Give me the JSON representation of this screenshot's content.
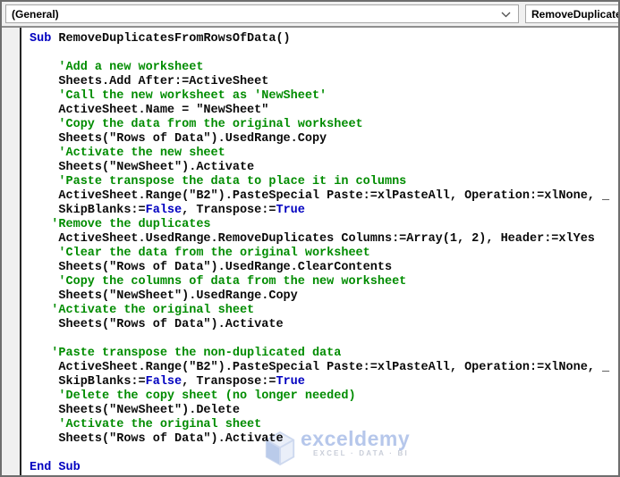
{
  "toolbar": {
    "object_dropdown": {
      "value": "(General)"
    },
    "procedure_dropdown": {
      "value": "RemoveDuplicatesF"
    }
  },
  "watermark": {
    "brand": "exceldemy",
    "tagline": "EXCEL · DATA · BI"
  },
  "colors": {
    "keyword": "#0000c0",
    "comment": "#008c00",
    "code_text": "#0a0a0a",
    "watermark_brand": "#b3c5ea",
    "margin_bar_bg": "#f0f0f0"
  },
  "code": {
    "lines": [
      [
        {
          "c": "k",
          "t": "Sub"
        },
        {
          "c": "d",
          "t": " RemoveDuplicatesFromRowsOfData()"
        }
      ],
      [],
      [
        {
          "c": "c",
          "t": "    'Add a new worksheet"
        }
      ],
      [
        {
          "c": "d",
          "t": "    Sheets.Add After:=ActiveSheet"
        }
      ],
      [
        {
          "c": "c",
          "t": "    'Call the new worksheet as 'NewSheet'"
        }
      ],
      [
        {
          "c": "d",
          "t": "    ActiveSheet.Name = \"NewSheet\""
        }
      ],
      [
        {
          "c": "c",
          "t": "    'Copy the data from the original worksheet"
        }
      ],
      [
        {
          "c": "d",
          "t": "    Sheets(\"Rows of Data\").UsedRange.Copy"
        }
      ],
      [
        {
          "c": "c",
          "t": "    'Activate the new sheet"
        }
      ],
      [
        {
          "c": "d",
          "t": "    Sheets(\"NewSheet\").Activate"
        }
      ],
      [
        {
          "c": "c",
          "t": "    'Paste transpose the data to place it in columns"
        }
      ],
      [
        {
          "c": "d",
          "t": "    ActiveSheet.Range(\"B2\").PasteSpecial Paste:=xlPasteAll, Operation:=xlNone, _"
        }
      ],
      [
        {
          "c": "d",
          "t": "    SkipBlanks:="
        },
        {
          "c": "k",
          "t": "False"
        },
        {
          "c": "d",
          "t": ", Transpose:="
        },
        {
          "c": "k",
          "t": "True"
        }
      ],
      [
        {
          "c": "c",
          "t": "   'Remove the duplicates"
        }
      ],
      [
        {
          "c": "d",
          "t": "    ActiveSheet.UsedRange.RemoveDuplicates Columns:=Array(1, 2), Header:=xlYes"
        }
      ],
      [
        {
          "c": "c",
          "t": "    'Clear the data from the original worksheet"
        }
      ],
      [
        {
          "c": "d",
          "t": "    Sheets(\"Rows of Data\").UsedRange.ClearContents"
        }
      ],
      [
        {
          "c": "c",
          "t": "    'Copy the columns of data from the new worksheet"
        }
      ],
      [
        {
          "c": "d",
          "t": "    Sheets(\"NewSheet\").UsedRange.Copy"
        }
      ],
      [
        {
          "c": "c",
          "t": "   'Activate the original sheet"
        }
      ],
      [
        {
          "c": "d",
          "t": "    Sheets(\"Rows of Data\").Activate"
        }
      ],
      [],
      [
        {
          "c": "c",
          "t": "   'Paste transpose the non-duplicated data"
        }
      ],
      [
        {
          "c": "d",
          "t": "    ActiveSheet.Range(\"B2\").PasteSpecial Paste:=xlPasteAll, Operation:=xlNone, _"
        }
      ],
      [
        {
          "c": "d",
          "t": "    SkipBlanks:="
        },
        {
          "c": "k",
          "t": "False"
        },
        {
          "c": "d",
          "t": ", Transpose:="
        },
        {
          "c": "k",
          "t": "True"
        }
      ],
      [
        {
          "c": "c",
          "t": "    'Delete the copy sheet (no longer needed)"
        }
      ],
      [
        {
          "c": "d",
          "t": "    Sheets(\"NewSheet\").Delete"
        }
      ],
      [
        {
          "c": "c",
          "t": "    'Activate the original sheet"
        }
      ],
      [
        {
          "c": "d",
          "t": "    Sheets(\"Rows of Data\").Activate"
        }
      ],
      [],
      [
        {
          "c": "k",
          "t": "End Sub"
        }
      ]
    ]
  }
}
